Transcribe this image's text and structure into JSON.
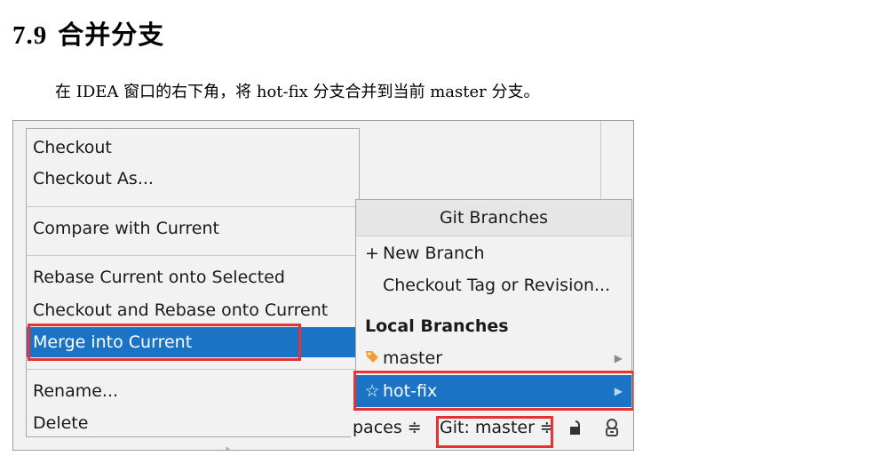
{
  "heading": {
    "number": "7.9",
    "title": "合并分支"
  },
  "paragraph": "在 IDEA 窗口的右下角，将 hot-fix 分支合并到当前 master 分支。",
  "context_menu": {
    "items": [
      {
        "label": "Checkout"
      },
      {
        "label": "Checkout As..."
      },
      {
        "label": "Compare with Current"
      },
      {
        "label": "Rebase Current onto Selected"
      },
      {
        "label": "Checkout and Rebase onto Current"
      },
      {
        "label": "Merge into Current"
      },
      {
        "label": "Rename..."
      },
      {
        "label": "Delete"
      }
    ]
  },
  "branches_popup": {
    "title": "Git Branches",
    "new_branch": "New Branch",
    "checkout_tag": "Checkout Tag or Revision...",
    "local_header": "Local Branches",
    "local": [
      {
        "name": "master"
      },
      {
        "name": "hot-fix"
      }
    ]
  },
  "status_bar": {
    "spaces": "paces ≑",
    "git": "Git: master ≑"
  },
  "colors": {
    "selection": "#1a73c4",
    "highlight_box": "#e53333"
  }
}
